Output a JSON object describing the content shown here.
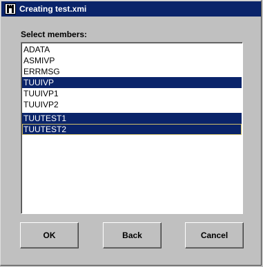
{
  "window": {
    "title": "Creating test.xmi",
    "icon": "app-figure-icon"
  },
  "members_label": "Select members:",
  "members": [
    {
      "label": "ADATA",
      "selected": false
    },
    {
      "label": "ASMIVP",
      "selected": false
    },
    {
      "label": "ERRMSG",
      "selected": false
    },
    {
      "label": "TUUIVP",
      "selected": true
    },
    {
      "label": "TUUIVP1",
      "selected": false
    },
    {
      "label": "TUUIVP2",
      "selected": false
    },
    {
      "label": "TUUTEST1",
      "selected": true
    },
    {
      "label": "TUUTEST2",
      "selected": true
    }
  ],
  "buttons": {
    "ok": "OK",
    "back": "Back",
    "cancel": "Cancel"
  },
  "colors": {
    "title_bar": "#0a246a",
    "selection": "#0a246a",
    "face": "#c0c0c0"
  }
}
